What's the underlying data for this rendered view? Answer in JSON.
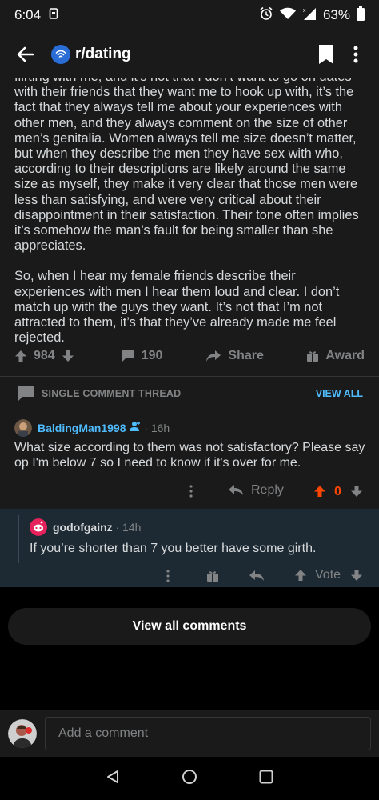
{
  "status_bar": {
    "time": "6:04",
    "battery": "63%"
  },
  "app_bar": {
    "subreddit": "r/dating"
  },
  "post": {
    "paragraphs": [
      "flirting with me, and it’s not that I don’t want to go on dates with their friends that they want me to hook up with, it’s the fact that they always tell me about your experiences with other men, and they always comment on the size of other men’s genitalia. Women always tell me size doesn’t matter, but when they describe the men they have sex with who, according to their descriptions are likely around the same size as myself, they make it very clear that those men were less than satisfying, and were very critical about their disappointment in their satisfaction. Their tone often implies it’s somehow the man’s fault for being smaller than she appreciates.",
      "So, when I hear my female friends describe their experiences with men I hear them loud and clear. I don’t match up with the guys they want. It’s not that I’m not attracted to them, it’s that they’ve already made me feel rejected."
    ],
    "votes": "984",
    "comments": "190",
    "share_label": "Share",
    "award_label": "Award"
  },
  "thread_bar": {
    "label": "SINGLE COMMENT THREAD",
    "view_all": "VIEW ALL"
  },
  "comment1": {
    "username": "BaldingMan1998",
    "time": "16h",
    "text": "What size according to them was not satisfactory? Please say op I'm below 7 so I need to know if it's over for me.",
    "reply_label": "Reply",
    "score": "0",
    "colors": {
      "username": "#4fbcff",
      "upvote": "#ff4500",
      "score": "#ff4500"
    }
  },
  "comment2": {
    "username": "godofgainz",
    "time": "14h",
    "text": "If you’re shorter than 7 you better have some girth.",
    "vote_label": "Vote"
  },
  "view_all_comments": "View all comments",
  "composer": {
    "placeholder": "Add a comment"
  }
}
